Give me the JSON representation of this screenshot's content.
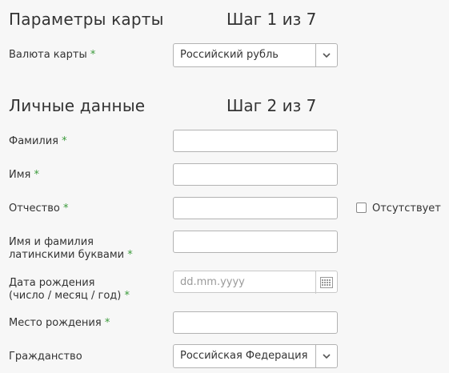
{
  "sections": {
    "card_params": {
      "title": "Параметры карты",
      "step": "Шаг 1 из 7"
    },
    "personal": {
      "title": "Личные данные",
      "step": "Шаг 2 из 7"
    }
  },
  "card": {
    "currency_label": "Валюта карты",
    "currency_value": "Российский рубль"
  },
  "personal": {
    "last_name_label": "Фамилия",
    "first_name_label": "Имя",
    "middle_name_label": "Отчество",
    "no_middle_name_label": "Отсутствует",
    "latin_name_label_line1": "Имя и фамилия",
    "latin_name_label_line2": "латинскими буквами",
    "birth_date_label_line1": "Дата рождения",
    "birth_date_label_line2": "(число / месяц / год)",
    "birth_date_placeholder": "dd.mm.yyyy",
    "birth_place_label": "Место рождения",
    "citizenship_label": "Гражданство",
    "citizenship_value": "Российская Федерация"
  },
  "required_mark": "*",
  "colors": {
    "required": "#3a9a3a",
    "border": "#b3b3b3",
    "background": "#f7f7f7"
  },
  "icons": {
    "select_arrow": "chevron-down-icon",
    "date": "calendar-icon"
  }
}
